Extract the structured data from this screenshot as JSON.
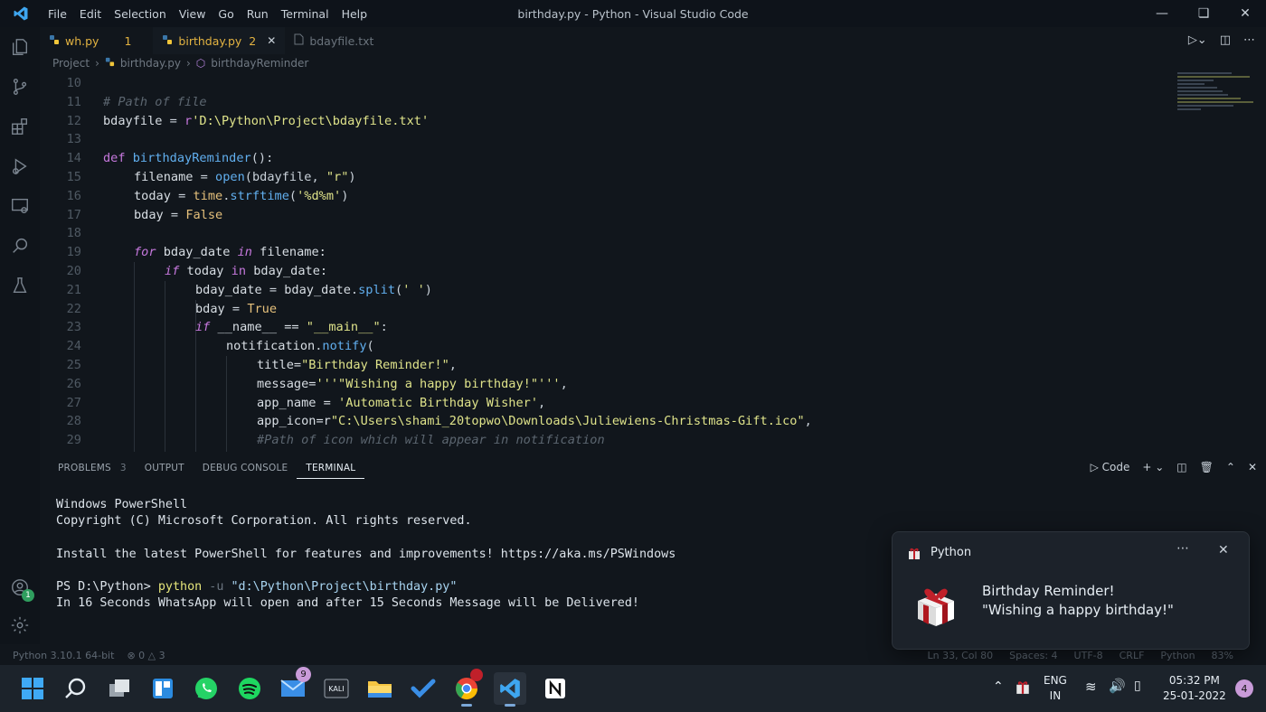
{
  "window": {
    "title": "birthday.py - Python - Visual Studio Code",
    "menu": [
      "File",
      "Edit",
      "Selection",
      "View",
      "Go",
      "Run",
      "Terminal",
      "Help"
    ]
  },
  "tabs": [
    {
      "label": "wh.py",
      "count": "1"
    },
    {
      "label": "birthday.py",
      "count": "2"
    },
    {
      "label": "bdayfile.txt"
    }
  ],
  "breadcrumb": [
    "Project",
    "birthday.py",
    "birthdayReminder"
  ],
  "editor": {
    "line_numbers": [
      "10",
      "11",
      "12",
      "13",
      "14",
      "15",
      "16",
      "17",
      "18",
      "19",
      "20",
      "21",
      "22",
      "23",
      "24",
      "25",
      "26",
      "27",
      "28",
      "29"
    ],
    "comment_11": "# Path of file",
    "var_bdayfile": "bdayfile",
    "eq": " = ",
    "r_prefix": "r",
    "str_path": "'D:\\Python\\Project\\bdayfile.txt'",
    "kw_def": "def ",
    "fn_name": "birthdayReminder",
    "paren_colon": "():",
    "filename": "filename",
    "open_fn": "open",
    "open_args_a": "(bdayfile, ",
    "str_r": "\"r\"",
    "close_paren": ")",
    "today": "today",
    "time_mod": "time",
    "dot": ".",
    "strftime": "strftime",
    "open_paren": "(",
    "str_fmt": "'%d%m'",
    "bday": "bday",
    "false_kw": "False",
    "kw_for": "for",
    "bday_date": " bday_date ",
    "kw_in": "in",
    "filename_colon": " filename:",
    "kw_if": "if",
    "today_sp": " today ",
    "in_sp": "in",
    "bday_date_colon": " bday_date:",
    "bday_date_var": "bday_date",
    "split_fn": "split",
    "str_space": "' '",
    "true_kw": "True",
    "name_dunder": " __name__ == ",
    "str_main": "\"__main__\"",
    "colon": ":",
    "notification": "notification",
    "notify": "notify",
    "title_kw": "title=",
    "str_title": "\"Birthday Reminder!\"",
    "comma": ",",
    "message_kw": "message=",
    "str_message": "'''\"Wishing a happy birthday!\"'''",
    "app_name_kw": "app_name = ",
    "str_app_name": "'Automatic Birthday Wisher'",
    "app_icon_kw": "app_icon=r",
    "str_app_icon": "\"C:\\Users\\shami_20topwo\\Downloads\\Juliewiens-Christmas-Gift.ico\"",
    "comment_29": "#Path of icon which will appear in notification"
  },
  "panel": {
    "tabs": [
      "PROBLEMS",
      "OUTPUT",
      "DEBUG CONSOLE",
      "TERMINAL"
    ],
    "problems_count": "3",
    "shell": "Code"
  },
  "terminal": {
    "line1": "Windows PowerShell",
    "line2": "Copyright (C) Microsoft Corporation. All rights reserved.",
    "line3": "Install the latest PowerShell for features and improvements! https://aka.ms/PSWindows",
    "prompt": "PS D:\\Python> ",
    "cmd": "python",
    "flag": " -u ",
    "arg": "\"d:\\Python\\Project\\birthday.py\"",
    "output": "In 16 Seconds WhatsApp will open and after 15 Seconds Message will be Delivered!"
  },
  "statusbar": {
    "interpreter": "Python 3.10.1 64-bit",
    "errors": "0",
    "warnings": "3",
    "position": "Ln 33, Col 80",
    "spaces": "Spaces: 4",
    "encoding": "UTF-8",
    "eol": "CRLF",
    "language": "Python",
    "zoom": "83%"
  },
  "toast": {
    "app": "Python",
    "title": "Birthday Reminder!",
    "message": "\"Wishing a happy birthday!\""
  },
  "taskbar": {
    "mail_badge": "9",
    "kali_label": "KALI",
    "lang_top": "ENG",
    "lang_bottom": "IN",
    "time": "05:32 PM",
    "date": "25-01-2022",
    "notifications": "4"
  },
  "colors": {
    "accent": "#61afef",
    "keyword": "#c678dd",
    "string": "#dfe38a",
    "active_tab": "#e3b341"
  }
}
